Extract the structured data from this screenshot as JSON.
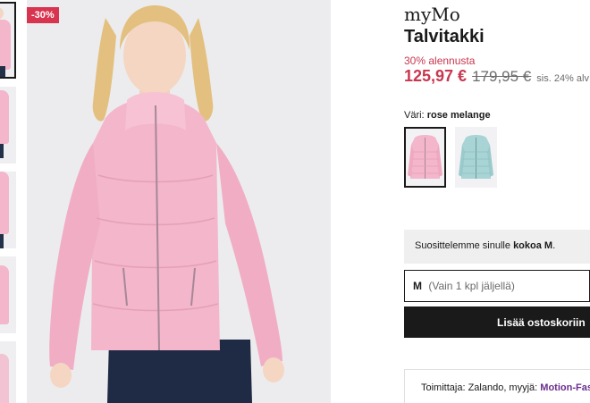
{
  "gallery": {
    "badge": "-30%",
    "thumbnail_count": 5,
    "main_colors": {
      "background": "#ececee",
      "coat": "#f3b6cb",
      "jeans": "#1f2b45",
      "hair": "#e3c07f"
    }
  },
  "product": {
    "brand": "myMo",
    "name": "Talvitakki",
    "discount_text": "30% alennusta",
    "price_current": "125,97 €",
    "price_original": "179,95 €",
    "vat_note": "sis. 24% alv"
  },
  "color": {
    "label": "Väri:",
    "value": "rose melange",
    "options": [
      {
        "name": "rose melange",
        "hex": "#f3b6cb",
        "selected": true
      },
      {
        "name": "light blue",
        "hex": "#a8d4d6",
        "selected": false
      }
    ]
  },
  "size": {
    "recommendation_prefix": "Suosittelemme sinulle ",
    "recommendation_size": "kokoa M",
    "recommendation_suffix": ".",
    "selected": "M",
    "stock_note": "(Vain 1 kpl jäljellä)"
  },
  "cart": {
    "button_label": "Lisää ostoskoriin"
  },
  "delivery": {
    "prefix": "Toimittaja: Zalando, myyjä: ",
    "seller": "Motion-Fashion"
  },
  "colors": {
    "sale_red": "#c8374f",
    "badge_red": "#d8334f",
    "seller_purple": "#6b2d8f",
    "button_black": "#1a1a1a"
  }
}
